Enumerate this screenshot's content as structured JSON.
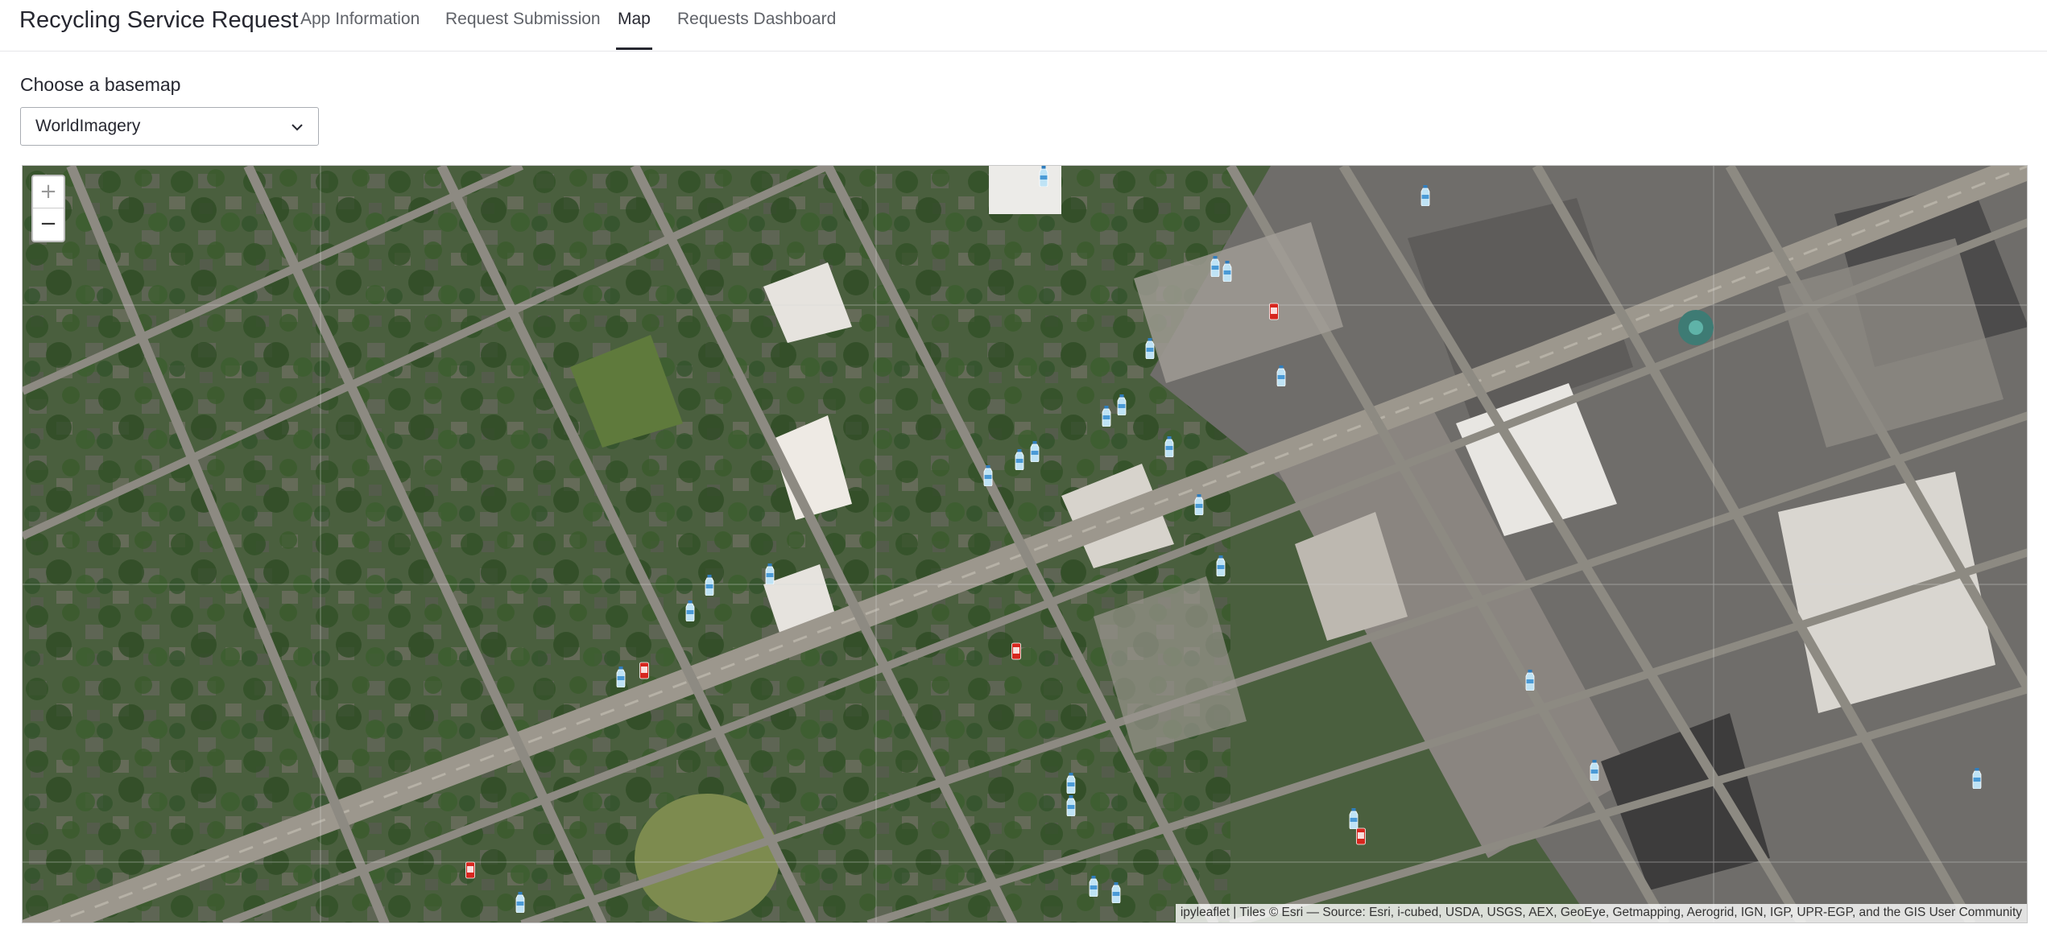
{
  "app": {
    "title": "Recycling Service Request"
  },
  "nav": {
    "tabs": [
      {
        "label": "App Information",
        "active": false
      },
      {
        "label": "Request Submission",
        "active": false
      },
      {
        "label": "Map",
        "active": true
      },
      {
        "label": "Requests Dashboard",
        "active": false
      }
    ]
  },
  "basemap": {
    "label": "Choose a basemap",
    "selected": "WorldImagery"
  },
  "map": {
    "zoom_in_label": "+",
    "zoom_out_label": "−",
    "attribution": "ipyleaflet | Tiles © Esri — Source: Esri, i-cubed, USDA, USGS, AEX, GeoEye, Getmapping, Aerogrid, IGN, IGP, UPR-EGP, and the GIS User Community",
    "marker_types": [
      "water-bottle-icon",
      "soda-can-icon"
    ],
    "marker_colors": {
      "bottle": "#bfe3f5",
      "bottle_cap": "#2f7dbd",
      "can": "#d7261e"
    }
  }
}
